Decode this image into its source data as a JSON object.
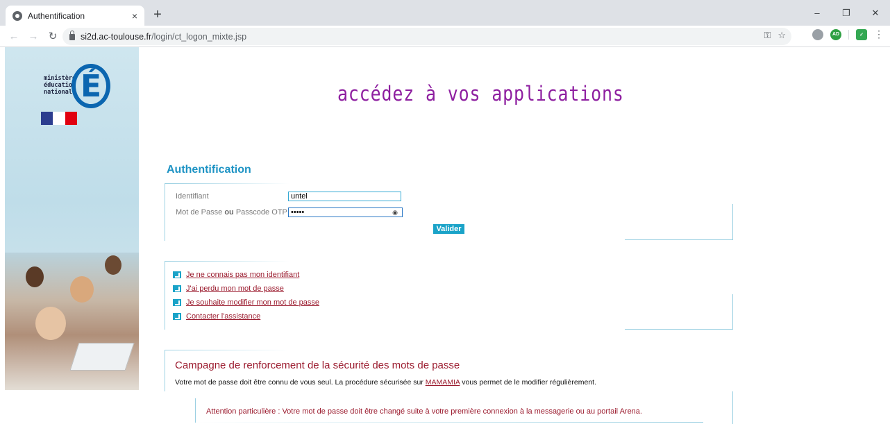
{
  "browser": {
    "tab_title": "Authentification",
    "tab_close": "×",
    "new_tab": "+",
    "url_host": "si2d.ac-toulouse.fr",
    "url_path": "/login/ct_logon_mixte.jsp",
    "window_controls": {
      "minimize": "–",
      "restore": "❐",
      "close": "✕"
    }
  },
  "logo": {
    "lines": [
      "ministère",
      "éducation",
      "nationale"
    ],
    "letter": "É"
  },
  "page": {
    "headline": "accédez à vos applications",
    "section_title": "Authentification"
  },
  "form": {
    "identifier_label": "Identifiant",
    "identifier_value": "untel",
    "password_label_a": "Mot de Passe ",
    "password_label_b": "ou",
    "password_label_c": " Passcode OTP",
    "password_value": "•••••",
    "submit_label": "Valider"
  },
  "links": [
    "Je ne connais pas mon identifiant",
    "J'ai perdu mon mot de passe",
    "Je souhaite modifier mon mot de passe",
    "Contacter l'assistance"
  ],
  "campaign": {
    "title": "Campagne de renforcement de la sécurité des mots de passe",
    "text_before": "Votre mot de passe doit être connu de vous seul. La procédure sécurisée sur ",
    "link": "MAMAMIA",
    "text_after": " vous permet de le modifier régulièrement.",
    "notice": "Attention particulière : Votre mot de passe doit être changé suite à votre première connexion à la messagerie ou au portail Arena."
  },
  "colors": {
    "headline": "#8e1fa0",
    "accent": "#1aa3c8",
    "link": "#9b1b2e"
  }
}
